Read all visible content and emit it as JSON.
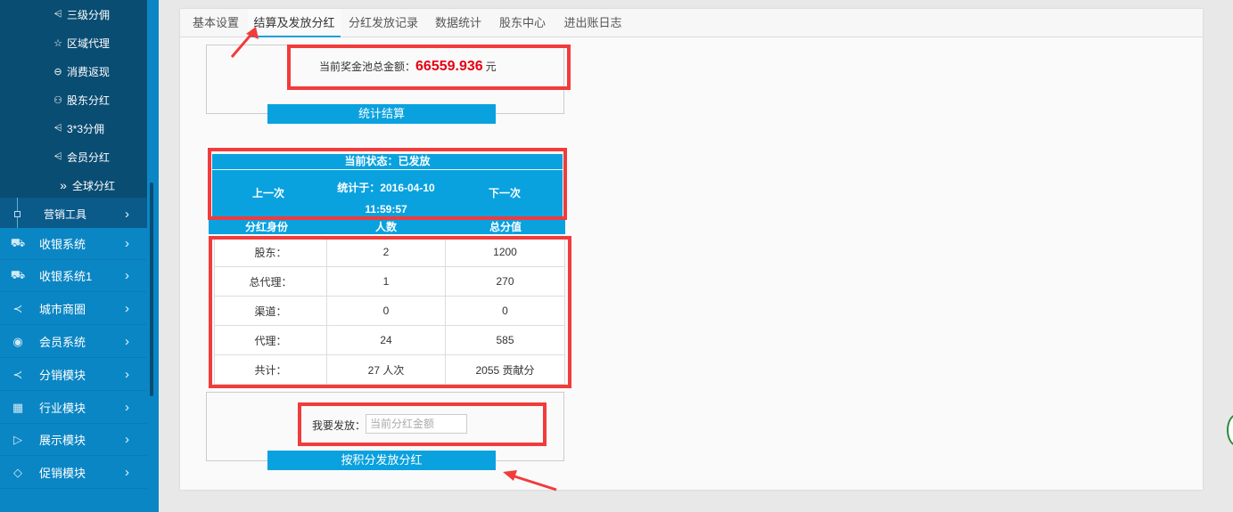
{
  "sidebar": {
    "sub_items": [
      {
        "icon": "org-icon",
        "glyph": "⩤",
        "label": "三级分佣"
      },
      {
        "icon": "star-icon",
        "glyph": "☆",
        "label": "区域代理"
      },
      {
        "icon": "cycle-icon",
        "glyph": "⊖",
        "label": "消费返现"
      },
      {
        "icon": "users-icon",
        "glyph": "⚇",
        "label": "股东分红"
      },
      {
        "icon": "org-icon",
        "glyph": "⩤",
        "label": "3*3分佣"
      },
      {
        "icon": "org-icon",
        "glyph": "⩤",
        "label": "会员分红"
      },
      {
        "icon": "double-chevron-icon",
        "glyph": "»",
        "label": "全球分红"
      }
    ],
    "tools_label": "营销工具",
    "menu": [
      {
        "icon": "cart-icon",
        "glyph": "⛟",
        "label": "收银系统"
      },
      {
        "icon": "cart-icon",
        "glyph": "⛟",
        "label": "收银系统1"
      },
      {
        "icon": "share-icon",
        "glyph": "≺",
        "label": "城市商圈"
      },
      {
        "icon": "vip-icon",
        "glyph": "◉",
        "label": "会员系统"
      },
      {
        "icon": "share-icon",
        "glyph": "≺",
        "label": "分销模块"
      },
      {
        "icon": "grid-icon",
        "glyph": "▦",
        "label": "行业模块"
      },
      {
        "icon": "play-icon",
        "glyph": "▷",
        "label": "展示模块"
      },
      {
        "icon": "tag-icon",
        "glyph": "◇",
        "label": "促销模块"
      }
    ],
    "chevron": "›"
  },
  "tabs": [
    {
      "label": "基本设置"
    },
    {
      "label": "结算及发放分红"
    },
    {
      "label": "分红发放记录"
    },
    {
      "label": "数据统计"
    },
    {
      "label": "股东中心"
    },
    {
      "label": "进出账日志"
    }
  ],
  "pool": {
    "label": "当前奖金池总金额：",
    "amount": "66559.936",
    "unit": "元",
    "amount_color": "#e60012"
  },
  "settle_button": "统计结算",
  "status": {
    "title": "当前状态：已发放",
    "prev": "上一次",
    "next": "下一次",
    "date_line1": "统计于：2016-04-10",
    "date_line2": "11:59:57"
  },
  "table": {
    "headers": [
      "分红身份",
      "人数",
      "总分值"
    ],
    "rows": [
      [
        "股东：",
        "2",
        "1200"
      ],
      [
        "总代理：",
        "1",
        "270"
      ],
      [
        "渠道：",
        "0",
        "0"
      ],
      [
        "代理：",
        "24",
        "585"
      ],
      [
        "共计：",
        "27 人次",
        "2055 贡献分"
      ]
    ]
  },
  "issue": {
    "label": "我要发放：",
    "placeholder": "当前分红金额",
    "button": "按积分发放分红"
  },
  "colors": {
    "accent": "#0aa1df",
    "highlight_border": "#f23b3b",
    "sidebar_dark": "#0a4d73"
  }
}
